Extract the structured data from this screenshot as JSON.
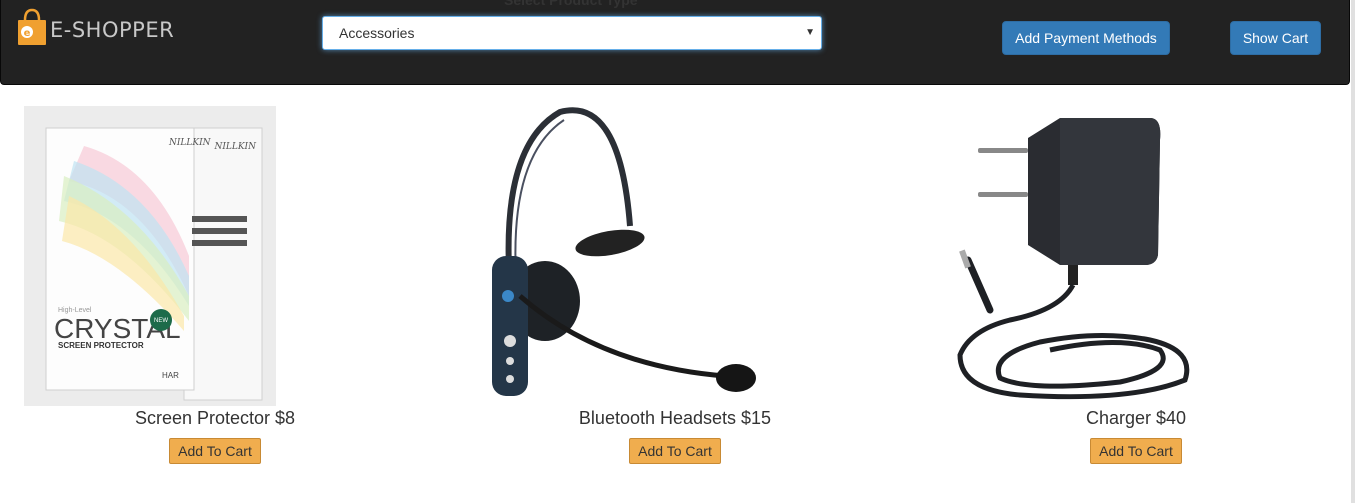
{
  "header": {
    "brand": "E-SHOPPER",
    "select_label": "Select Product Type",
    "selected_type": "Accessories",
    "add_payment_label": "Add Payment Methods",
    "show_cart_label": "Show Cart"
  },
  "products": [
    {
      "name": "Screen Protector $8",
      "button": "Add To Cart",
      "image_text": [
        "NILLKIN",
        "High-Level",
        "CRYSTAL",
        "SCREEN PROTECTOR",
        "NEW",
        "HAR"
      ]
    },
    {
      "name": "Bluetooth Headsets $15",
      "button": "Add To Cart"
    },
    {
      "name": "Charger $40",
      "button": "Add To Cart"
    }
  ],
  "colors": {
    "navbar": "#222222",
    "primary": "#337ab7",
    "warning": "#f0ad4e",
    "logo": "#f0a030"
  }
}
